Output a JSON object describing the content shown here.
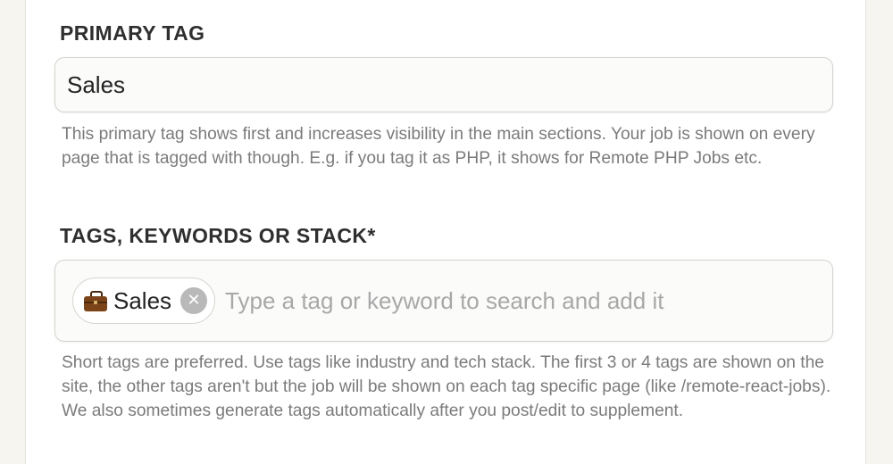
{
  "primary_tag": {
    "label": "PRIMARY TAG",
    "value": "Sales",
    "help": "This primary tag shows first and increases visibility in the main sections. Your job is shown on every page that is tagged with though. E.g. if you tag it as PHP, it shows for Remote PHP Jobs etc."
  },
  "tags": {
    "label": "TAGS, KEYWORDS OR STACK*",
    "chips": [
      {
        "label": "Sales",
        "icon": "briefcase-icon",
        "remove_glyph": "✕"
      }
    ],
    "search_placeholder": "Type a tag or keyword to search and add it",
    "help": "Short tags are preferred. Use tags like industry and tech stack. The first 3 or 4 tags are shown on the site, the other tags aren't but the job will be shown on each tag specific page (like /remote-react-jobs). We also sometimes generate tags automatically after you post/edit to supplement."
  },
  "colors": {
    "background": "#f7f5f0",
    "card": "#ffffff",
    "heading_text": "#2f2f2f",
    "help_text": "#7b7b7b",
    "input_border": "#d4d2cd",
    "chip_remove_bg": "#b9b9b9",
    "briefcase": "#7a4318"
  }
}
